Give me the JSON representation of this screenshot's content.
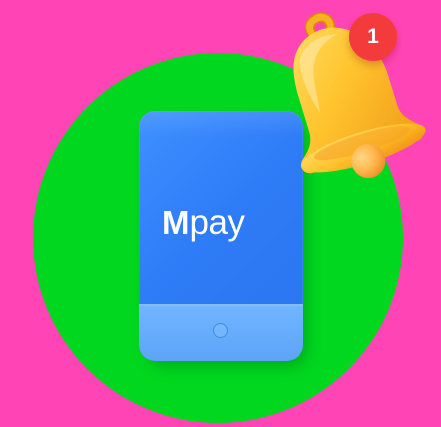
{
  "scene": {
    "background_color": "#ff45b5",
    "circle_color": "#00d71e",
    "phone": {
      "brand_text_first": "M",
      "brand_text_rest": "pay",
      "primary_color": "#2f7cf8",
      "lower_panel_color": "#62a9f8"
    },
    "notification": {
      "count": "1",
      "badge_color": "#f43b3b"
    },
    "icons": {
      "bell": "bell-icon",
      "phone": "phone-icon"
    }
  }
}
